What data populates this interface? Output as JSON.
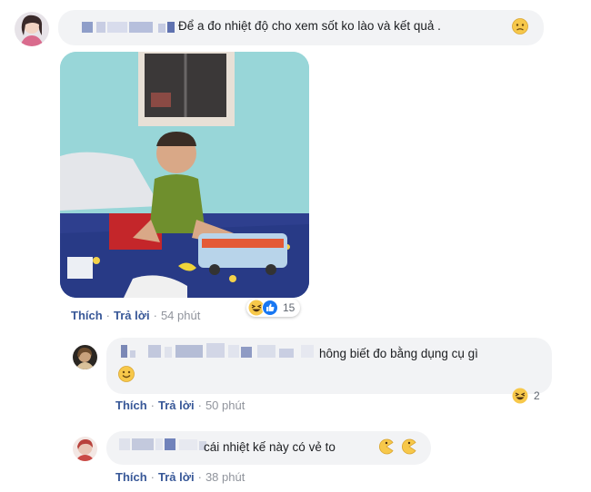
{
  "comments": [
    {
      "text": "Để a đo nhiệt độ cho xem sốt ko lào và kết quả .",
      "actions": {
        "like": "Thích",
        "reply": "Trả lời",
        "time": "54 phút"
      },
      "reaction_count": "15"
    },
    {
      "text": "hông biết đo bằng dụng cụ gì",
      "actions": {
        "like": "Thích",
        "reply": "Trả lời",
        "time": "50 phút"
      },
      "reaction_count": "2"
    },
    {
      "text": "cái nhiệt kế này có vẻ to",
      "actions": {
        "like": "Thích",
        "reply": "Trả lời",
        "time": "38 phút"
      }
    }
  ],
  "colors": {
    "link": "#385898",
    "muted": "#90949c",
    "bubble": "#f2f3f5",
    "like_blue": "#1877f2",
    "emoji_yellow": "#f7c84a"
  },
  "icons": [
    "sad-emoji-icon",
    "haha-reaction-icon",
    "like-reaction-icon",
    "smile-emoji-icon",
    "pacman-emoji-icon"
  ]
}
